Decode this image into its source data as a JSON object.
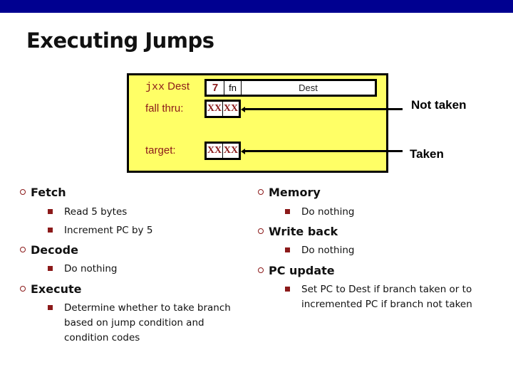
{
  "title": "Executing Jumps",
  "diagram": {
    "instruction_label": "jxx Dest",
    "instruction_label_mono": "jxx",
    "instruction_label_rest": " Dest",
    "opcode": "7",
    "function_field": "fn",
    "dest_field": "Dest",
    "fall_thru_label": "fall thru:",
    "target_label": "target:",
    "byte_placeholder": "XX",
    "not_taken_label": "Not taken",
    "taken_label": "Taken",
    "colors": {
      "box_fill": "#ffff66",
      "label_color": "#8b1a1a",
      "top_bar": "#000090"
    }
  },
  "left_column": [
    {
      "heading": "Fetch",
      "items": [
        "Read 5 bytes",
        "Increment PC by 5"
      ]
    },
    {
      "heading": "Decode",
      "items": [
        "Do nothing"
      ]
    },
    {
      "heading": "Execute",
      "items": [
        "Determine whether to take branch based on jump condition and condition codes"
      ]
    }
  ],
  "right_column": [
    {
      "heading": "Memory",
      "items": [
        "Do nothing"
      ]
    },
    {
      "heading": "Write back",
      "items": [
        "Do nothing"
      ]
    },
    {
      "heading": "PC update",
      "items": [
        "Set PC to Dest if branch taken or to incremented PC if branch not taken"
      ]
    }
  ]
}
